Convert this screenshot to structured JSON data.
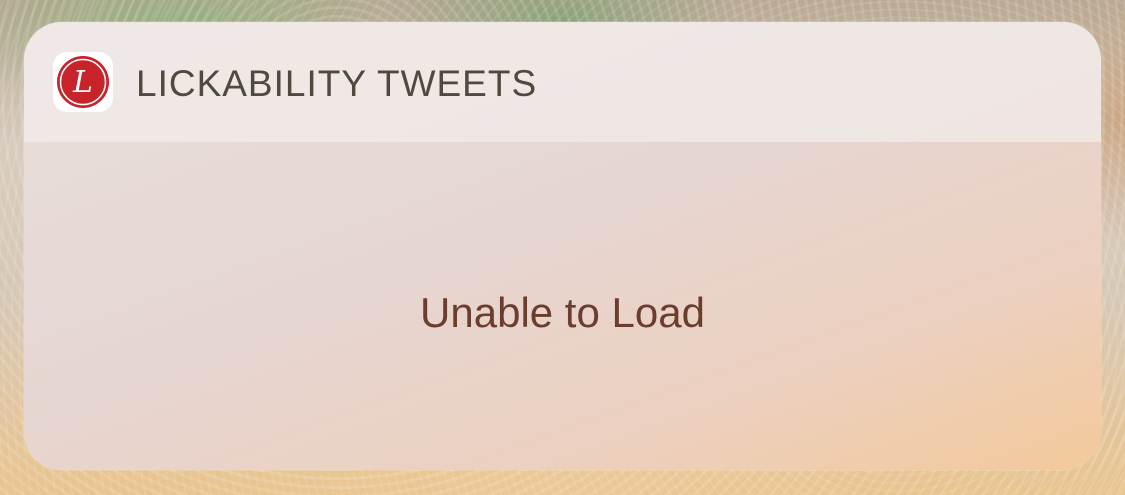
{
  "widget": {
    "app_name": "LICKABILITY TWEETS",
    "app_icon": "lickability-logo-icon",
    "message": "Unable to Load",
    "logo_letter": "L"
  },
  "colors": {
    "logo_red": "#c8232b",
    "header_text": "#4f4a40",
    "message_text": "#6b3d2e"
  }
}
